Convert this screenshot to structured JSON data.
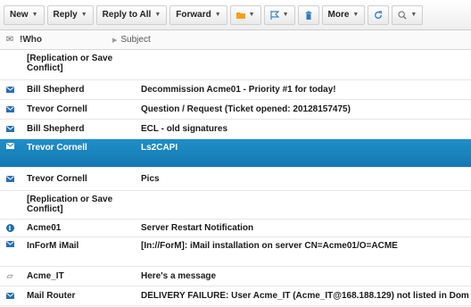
{
  "toolbar": {
    "new": "New",
    "reply": "Reply",
    "reply_all": "Reply to All",
    "forward": "Forward",
    "more": "More",
    "colors": {
      "folder": "#f0a21c",
      "flag": "#3b86c6",
      "trash": "#2e7bbf",
      "refresh": "#2e7bbf"
    }
  },
  "header": {
    "who": "Who",
    "subject": "Subject"
  },
  "rows": [
    {
      "icon": "",
      "who": "[Replication or Save Conflict]",
      "subject": "",
      "selected": false
    },
    {
      "icon": "envelope",
      "who": "Bill Shepherd",
      "subject": "Decommission Acme01 - Priority #1 for today!",
      "selected": false
    },
    {
      "icon": "envelope",
      "who": "Trevor Cornell",
      "subject": "Question / Request (Ticket opened: 20128157475)",
      "selected": false
    },
    {
      "icon": "envelope",
      "who": "Bill Shepherd",
      "subject": "ECL - old signatures",
      "selected": false
    },
    {
      "icon": "envelope",
      "who": "Trevor Cornell",
      "subject": "Ls2CAPI",
      "selected": true
    },
    {
      "icon": "envelope",
      "who": "Trevor Cornell",
      "subject": "Pics",
      "selected": false
    },
    {
      "icon": "",
      "who": "[Replication or Save Conflict]",
      "subject": "",
      "selected": false
    },
    {
      "icon": "info",
      "who": "Acme01",
      "subject": "Server Restart Notification",
      "selected": false
    },
    {
      "icon": "envelope",
      "who": "InForM iMail",
      "subject": "[In://ForM]: iMail installation on server CN=Acme01/O=ACME",
      "selected": false
    },
    {
      "icon": "note",
      "who": "Acme_IT",
      "subject": "Here's a message",
      "selected": false
    },
    {
      "icon": "envelope",
      "who": "Mail Router",
      "subject": "DELIVERY FAILURE: User Acme_IT (Acme_IT@168.188.129) not listed in Dom",
      "selected": false
    }
  ],
  "colors": {
    "selected_bg": "#1a84bf",
    "envelope": "#2a6fb0"
  }
}
